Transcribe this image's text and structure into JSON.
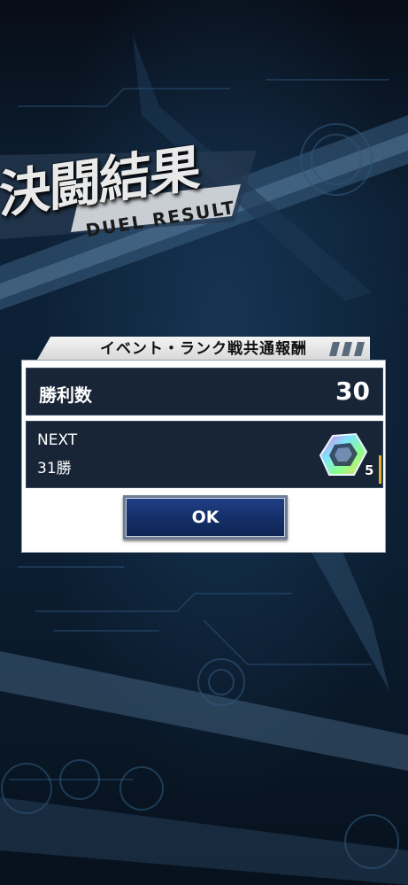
{
  "title": {
    "kanji": "決闘結果",
    "english": "DUEL RESULT"
  },
  "dialog": {
    "title": "イベント・ランク戦共通報酬",
    "wins_label": "勝利数",
    "wins_value": "30",
    "next_label": "NEXT",
    "next_value": "31勝",
    "reward_icon": "gem-icon",
    "reward_count": "5",
    "ok_label": "OK"
  },
  "colors": {
    "panel": "#172536",
    "button": "#15306a",
    "accent_bar": "#e0b12a"
  }
}
